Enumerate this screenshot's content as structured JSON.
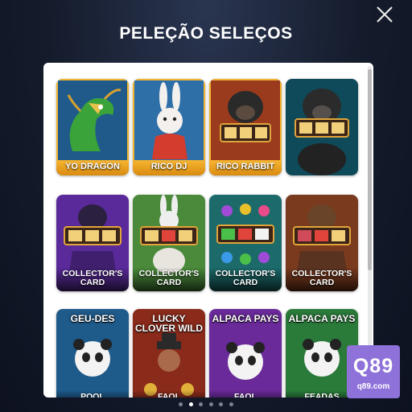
{
  "header": {
    "title": "PELEÇÃO SELEÇOS"
  },
  "tiles": [
    {
      "label": "YO DRAGON"
    },
    {
      "label": "RICO DJ"
    },
    {
      "label": "RICO RABBIT"
    },
    {
      "label": ""
    },
    {
      "label": "COLLECTOR'S CARD"
    },
    {
      "label": "COLLECTOR'S CARD"
    },
    {
      "label": "COLLECTOR'S CARD"
    },
    {
      "label": "COLLECTOR'S CARD"
    },
    {
      "title": "GEU-DES",
      "label": "POOL"
    },
    {
      "title": "LUCKY CLOVER WILD",
      "label": "FAOL"
    },
    {
      "title": "ALPACA PAYS",
      "label": "FAOL"
    },
    {
      "title": "ALPACA PAYS",
      "label": "FEADAS"
    }
  ],
  "pagination": {
    "count": 6,
    "active": 1
  },
  "watermark": {
    "line1": "Q89",
    "line2": "q89.com"
  },
  "colors": {
    "background": "#141b2b",
    "panel": "#ffffff",
    "gold_label": "#f0a626",
    "watermark": "#8e72d9"
  },
  "icons": {
    "close": "close-icon"
  }
}
